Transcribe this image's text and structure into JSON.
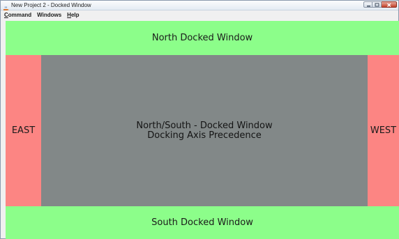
{
  "window": {
    "title": "New Project 2 - Docked Window"
  },
  "menubar": {
    "items": [
      {
        "label": "Command",
        "mnemonic": "C",
        "rest": "ommand"
      },
      {
        "label": "Windows",
        "mnemonic": "",
        "rest": "Windows"
      },
      {
        "label": "Help",
        "mnemonic": "H",
        "rest": "elp"
      }
    ]
  },
  "docks": {
    "north": "North Docked Window",
    "south": "South Docked Window",
    "east": "EAST",
    "west": "WEST",
    "center_line1": "North/South - Docked Window",
    "center_line2": "Docking Axis Precedence"
  },
  "colors": {
    "north_south": "#8cfe8a",
    "east_west": "#fc8583",
    "center": "#828888"
  },
  "icons": {
    "app": "java-coffee-icon",
    "minimize": "minimize-icon",
    "maximize": "maximize-icon",
    "close": "close-icon"
  }
}
